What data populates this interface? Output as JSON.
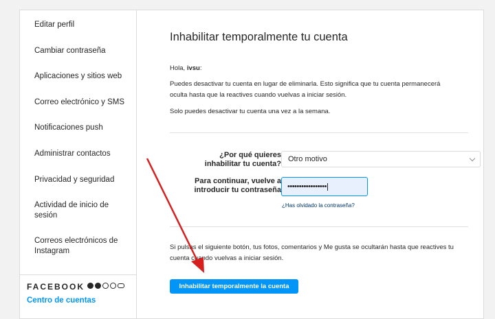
{
  "sidebar": {
    "items": [
      {
        "label": "Editar perfil"
      },
      {
        "label": "Cambiar contraseña"
      },
      {
        "label": "Aplicaciones y sitios web"
      },
      {
        "label": "Correo electrónico y SMS"
      },
      {
        "label": "Notificaciones push"
      },
      {
        "label": "Administrar contactos"
      },
      {
        "label": "Privacidad y seguridad"
      },
      {
        "label": "Actividad de inicio de sesión"
      },
      {
        "label": "Correos electrónicos de Instagram"
      }
    ],
    "footer": {
      "brand": "FACEBOOK",
      "icons": [
        "facebook-icon",
        "messenger-icon",
        "instagram-icon",
        "whatsapp-icon",
        "oculus-icon"
      ],
      "accounts_center": "Centro de cuentas"
    }
  },
  "main": {
    "title": "Inhabilitar temporalmente tu cuenta",
    "greeting_prefix": "Hola,",
    "username": "ivsu",
    "greeting_suffix": ":",
    "paragraph1": "Puedes desactivar tu cuenta en lugar de eliminarla. Esto significa que tu cuenta permanecerá oculta hasta que la reactives cuando vuelvas a iniciar sesión.",
    "paragraph2": "Solo puedes desactivar tu cuenta una vez a la semana.",
    "reason_label": "¿Por qué quieres inhabilitar tu cuenta?",
    "reason_value": "Otro motivo",
    "password_label": "Para continuar, vuelve a introducir tu contraseña",
    "password_value": "•••••••••••••••••",
    "forgot_link": "¿Has olvidado la contraseña?",
    "note": "Si pulsas el siguiente botón, tus fotos, comentarios y Me gusta se ocultarán hasta que reactives tu cuenta cuando vuelvas a iniciar sesión.",
    "submit_button": "Inhabilitar temporalmente la cuenta"
  },
  "colors": {
    "accent": "#0095f6",
    "annotation_arrow": "#d6201f"
  }
}
